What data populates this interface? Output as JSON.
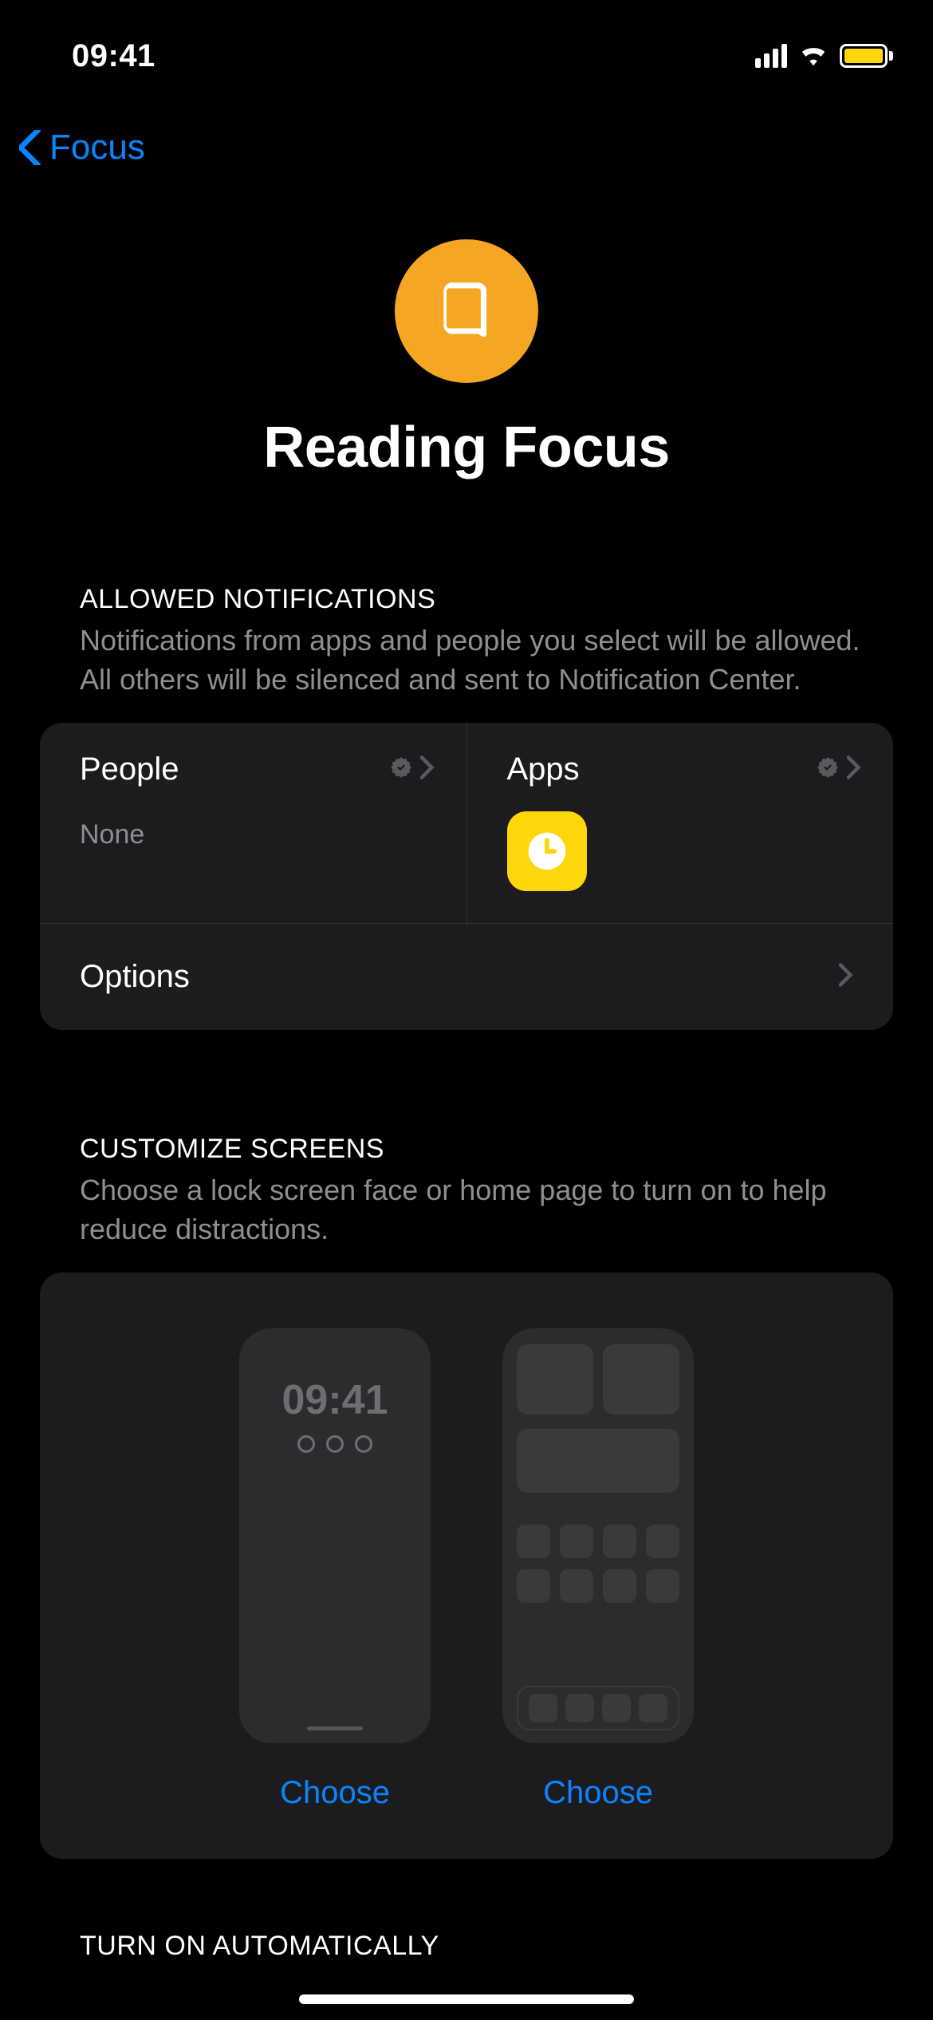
{
  "status_bar": {
    "time": "09:41"
  },
  "nav": {
    "back_label": "Focus"
  },
  "header": {
    "title": "Reading Focus",
    "icon_name": "book-icon",
    "icon_color": "#f5a623"
  },
  "allowed_notifications": {
    "header": "ALLOWED NOTIFICATIONS",
    "description": "Notifications from apps and people you select will be allowed. All others will be silenced and sent to Notification Center.",
    "people": {
      "label": "People",
      "summary": "None"
    },
    "apps": {
      "label": "Apps",
      "items": [
        {
          "name": "Clock",
          "icon": "clock-icon",
          "color": "#ffd60a"
        }
      ]
    },
    "options_label": "Options"
  },
  "customize_screens": {
    "header": "CUSTOMIZE SCREENS",
    "description": "Choose a lock screen face or home page to turn on to help reduce distractions.",
    "lock_screen": {
      "time": "09:41",
      "button": "Choose"
    },
    "home_screen": {
      "button": "Choose"
    }
  },
  "turn_on_auto": {
    "header": "TURN ON AUTOMATICALLY"
  }
}
